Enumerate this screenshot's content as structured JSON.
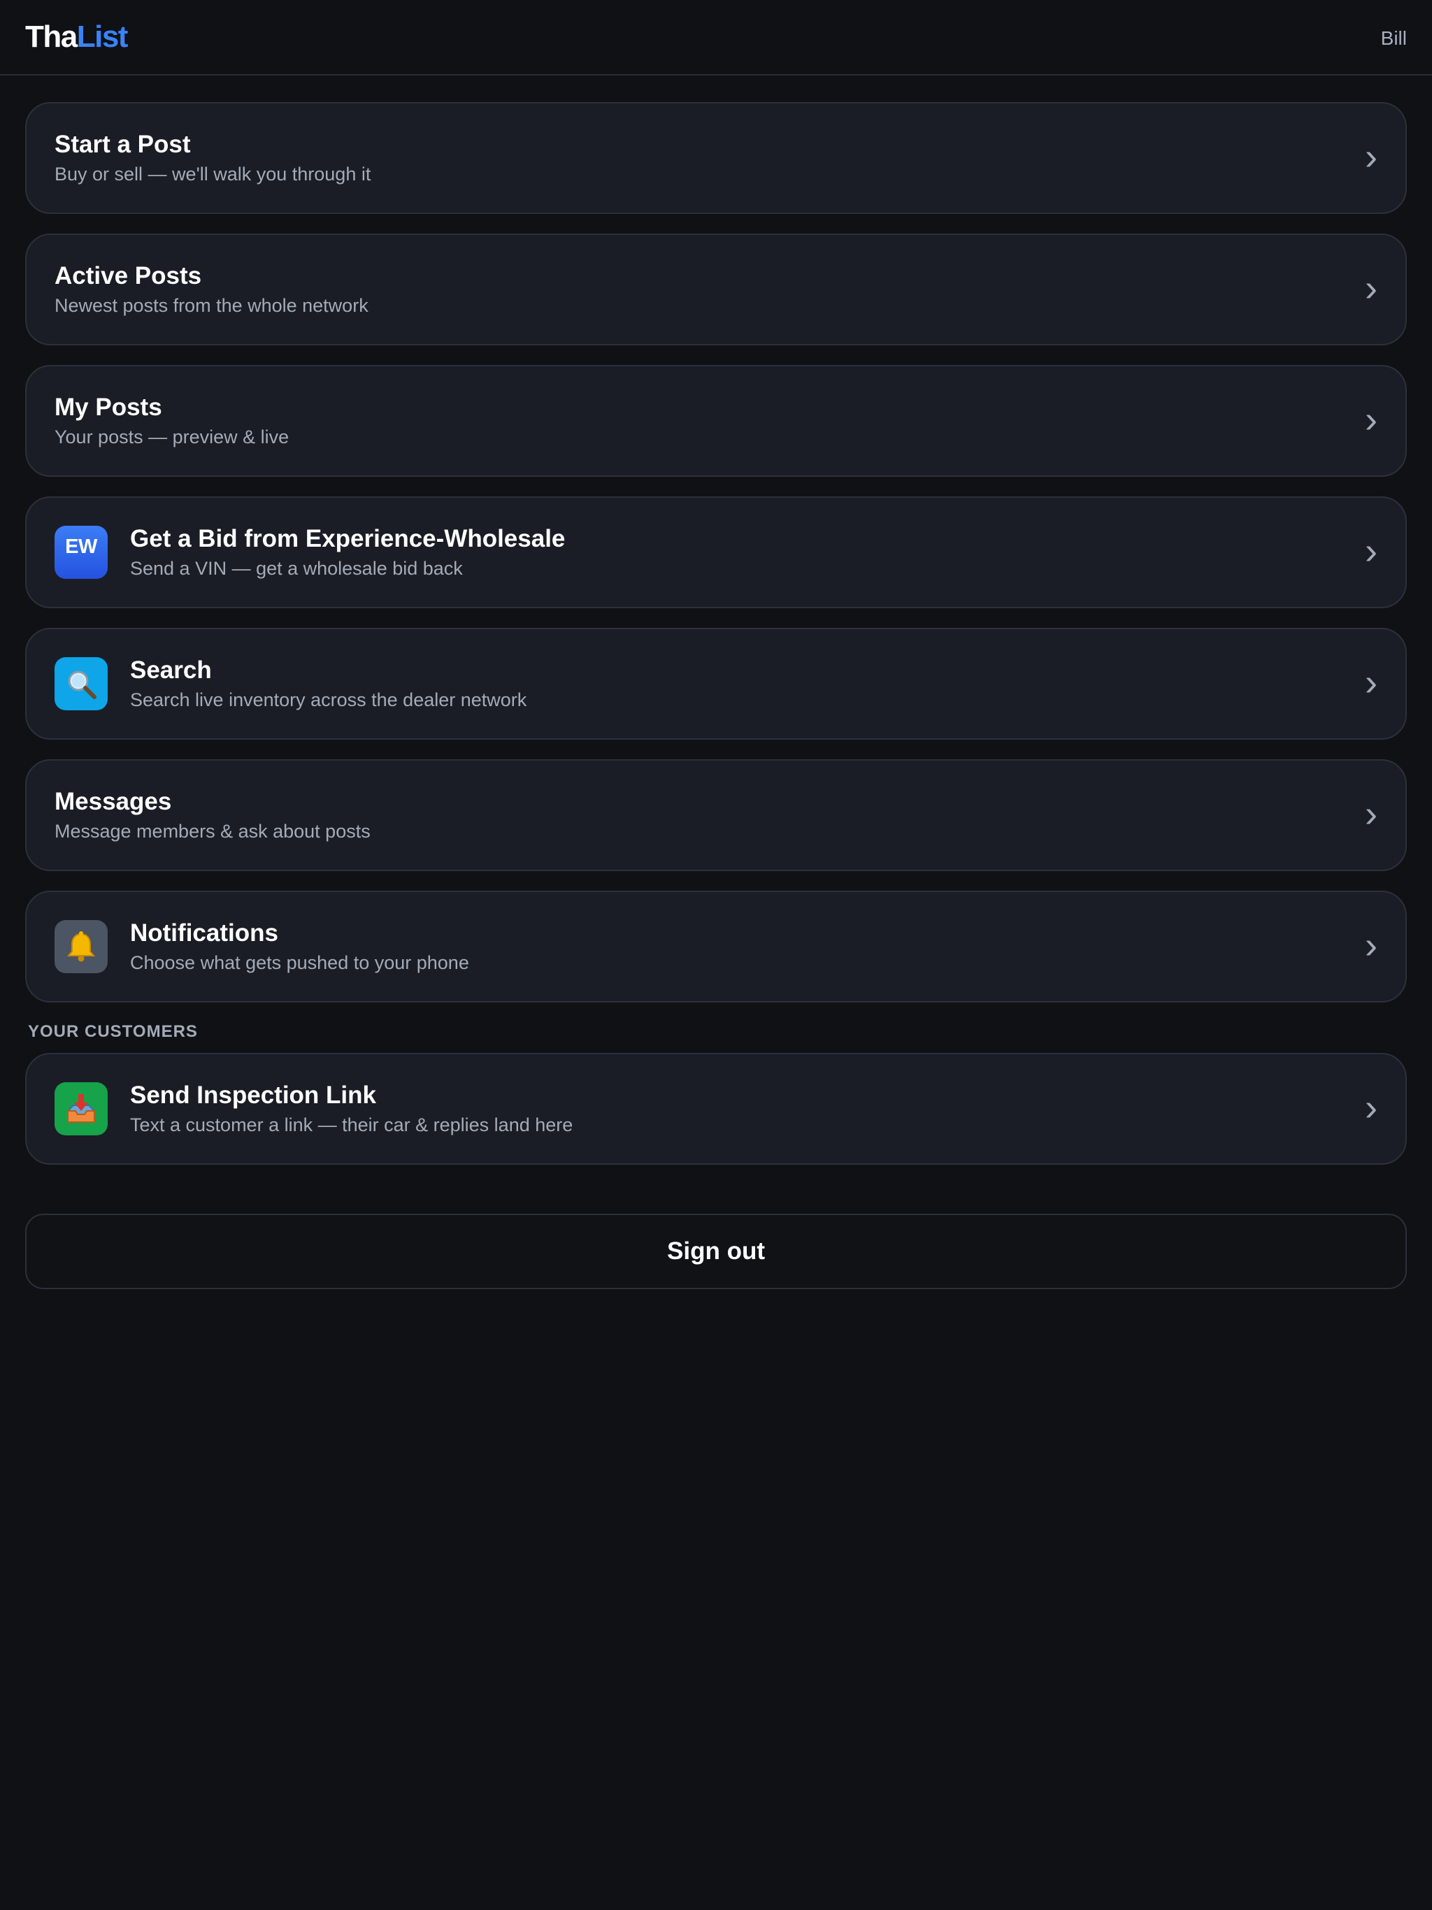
{
  "header": {
    "logo_part1": "Tha",
    "logo_part2": "List",
    "user_name": "Bill"
  },
  "colors": {
    "background": "#0f1115",
    "card": "#1a1d25",
    "accent": "#3b82f6",
    "search_icon_bg": "#0ea5e9",
    "bell_icon_bg": "#4b5563",
    "inbox_icon_bg": "#16a34a"
  },
  "menu": [
    {
      "title": "Start a Post",
      "subtitle": "Buy or sell — we'll walk you through it",
      "chevron": "›"
    },
    {
      "title": "Active Posts",
      "subtitle": "Newest posts from the whole network",
      "chevron": "›"
    },
    {
      "title": "My Posts",
      "subtitle": "Your posts — preview & live",
      "chevron": "›"
    },
    {
      "title": "Get a Bid from Experience-Wholesale",
      "subtitle": "Send a VIN — get a wholesale bid back",
      "icon": "ew-badge-icon",
      "icon_text": "EW",
      "chevron": "›"
    },
    {
      "title": "Search",
      "subtitle": "Search live inventory across the dealer network",
      "icon": "search-icon",
      "chevron": "›"
    },
    {
      "title": "Messages",
      "subtitle": "Message members & ask about posts",
      "chevron": "›"
    },
    {
      "title": "Notifications",
      "subtitle": "Choose what gets pushed to your phone",
      "icon": "bell-icon",
      "chevron": "›"
    }
  ],
  "customers_section": {
    "label": "YOUR CUSTOMERS",
    "items": [
      {
        "title": "Send Inspection Link",
        "subtitle": "Text a customer a link — their car & replies land here",
        "icon": "inbox-tray-icon",
        "chevron": "›"
      }
    ]
  },
  "signout_label": "Sign out"
}
